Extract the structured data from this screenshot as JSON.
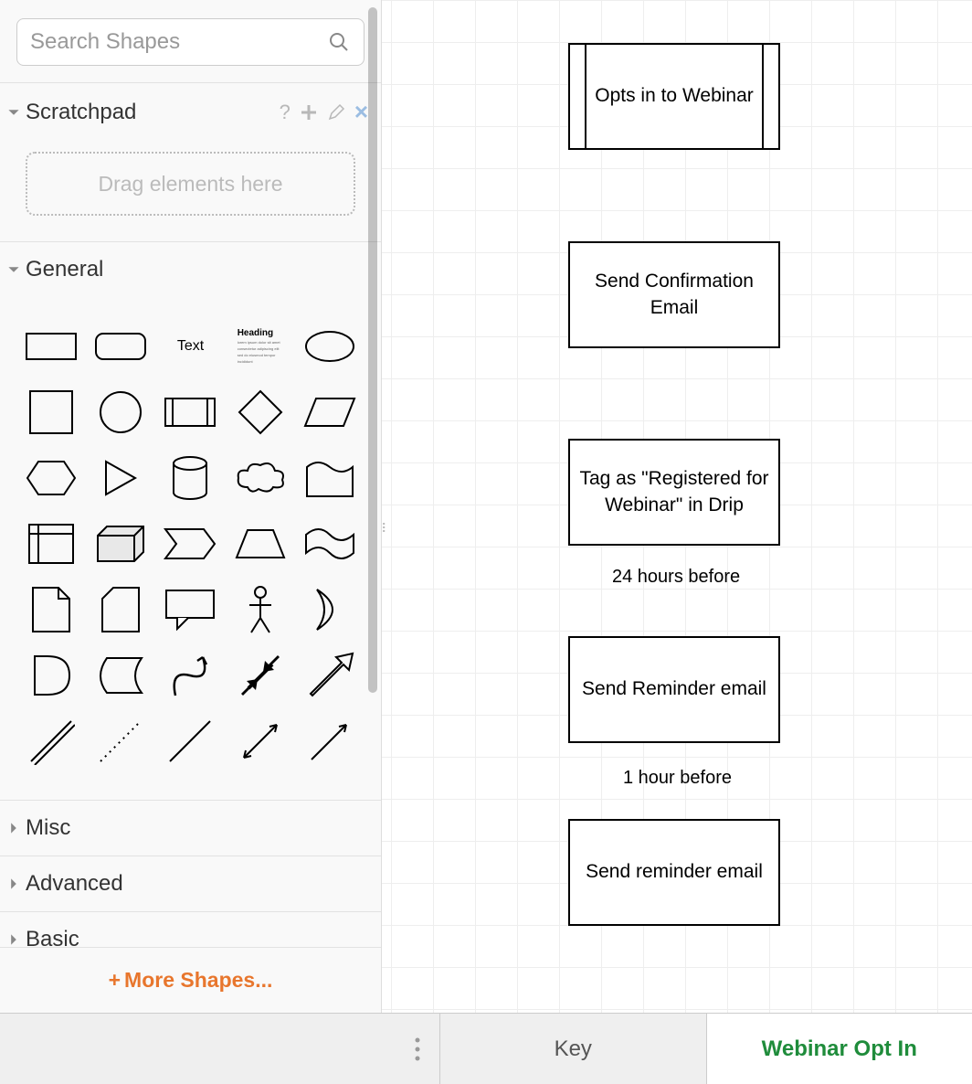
{
  "search": {
    "placeholder": "Search Shapes"
  },
  "sections": {
    "scratchpad": {
      "title": "Scratchpad",
      "drop_hint": "Drag elements here",
      "help_char": "?"
    },
    "general": {
      "title": "General",
      "shapes": [
        {
          "name": "rectangle"
        },
        {
          "name": "rounded-rectangle"
        },
        {
          "name": "text",
          "label": "Text"
        },
        {
          "name": "heading",
          "label": "Heading"
        },
        {
          "name": "ellipse"
        },
        {
          "name": "square"
        },
        {
          "name": "circle"
        },
        {
          "name": "process-side"
        },
        {
          "name": "diamond"
        },
        {
          "name": "parallelogram"
        },
        {
          "name": "hexagon"
        },
        {
          "name": "triangle"
        },
        {
          "name": "cylinder"
        },
        {
          "name": "cloud"
        },
        {
          "name": "document-top"
        },
        {
          "name": "internal-storage"
        },
        {
          "name": "cube"
        },
        {
          "name": "step"
        },
        {
          "name": "trapezoid"
        },
        {
          "name": "tape"
        },
        {
          "name": "note"
        },
        {
          "name": "card"
        },
        {
          "name": "callout"
        },
        {
          "name": "actor"
        },
        {
          "name": "crescent"
        },
        {
          "name": "and-shape"
        },
        {
          "name": "data-storage"
        },
        {
          "name": "curve"
        },
        {
          "name": "bidirectional-arrow"
        },
        {
          "name": "arrow"
        },
        {
          "name": "double-line"
        },
        {
          "name": "dotted-line"
        },
        {
          "name": "line"
        },
        {
          "name": "line-bidir"
        },
        {
          "name": "line-arrow"
        }
      ]
    },
    "misc": {
      "title": "Misc"
    },
    "advanced": {
      "title": "Advanced"
    },
    "basic": {
      "title": "Basic"
    }
  },
  "more_shapes_label": "More Shapes...",
  "diagram": {
    "nodes": [
      {
        "id": "n1",
        "text": "Opts in to Webinar"
      },
      {
        "id": "n2",
        "text": "Send Confirmation Email"
      },
      {
        "id": "n3",
        "text": "Tag as \"Registered for Webinar\" in Drip"
      },
      {
        "id": "n4",
        "text": "Send Reminder email"
      },
      {
        "id": "n5",
        "text": "Send reminder email"
      }
    ],
    "edge_labels": [
      {
        "id": "e1",
        "text": "24 hours before"
      },
      {
        "id": "e2",
        "text": "1 hour before"
      }
    ]
  },
  "tabs": [
    {
      "id": "key",
      "label": "Key",
      "active": false
    },
    {
      "id": "webinar",
      "label": "Webinar Opt In",
      "active": true
    }
  ]
}
